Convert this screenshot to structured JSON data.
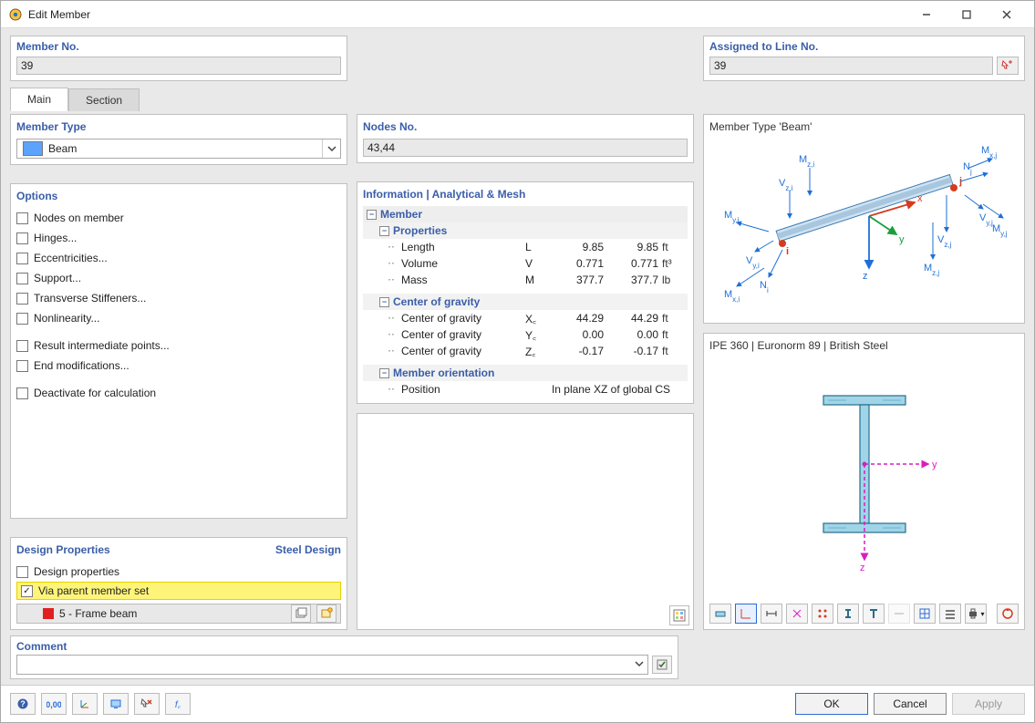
{
  "window": {
    "title": "Edit Member"
  },
  "top": {
    "member_no_label": "Member No.",
    "member_no_value": "39",
    "assigned_label": "Assigned to Line No.",
    "assigned_value": "39"
  },
  "tabs": {
    "main": "Main",
    "section": "Section"
  },
  "member_type": {
    "title": "Member Type",
    "value": "Beam"
  },
  "options": {
    "title": "Options",
    "items": [
      "Nodes on member",
      "Hinges...",
      "Eccentricities...",
      "Support...",
      "Transverse Stiffeners...",
      "Nonlinearity...",
      "Result intermediate points...",
      "End modifications...",
      "Deactivate for calculation"
    ]
  },
  "design_props": {
    "title": "Design Properties",
    "right_label": "Steel Design",
    "design_properties_label": "Design properties",
    "via_parent_label": "Via parent member set",
    "via_parent_checked": true,
    "frame_item": "5 - Frame beam"
  },
  "nodes": {
    "title": "Nodes No.",
    "value": "43,44"
  },
  "info": {
    "title": "Information | Analytical & Mesh",
    "member_label": "Member",
    "properties_label": "Properties",
    "rows": [
      {
        "name": "Length",
        "sym": "L",
        "v1": "9.85",
        "v2": "9.85",
        "unit": "ft"
      },
      {
        "name": "Volume",
        "sym": "V",
        "v1": "0.771",
        "v2": "0.771",
        "unit": "ft³"
      },
      {
        "name": "Mass",
        "sym": "M",
        "v1": "377.7",
        "v2": "377.7",
        "unit": "lb"
      }
    ],
    "cog_label": "Center of gravity",
    "cog_rows": [
      {
        "name": "Center of gravity",
        "sym": "X꜀",
        "v1": "44.29",
        "v2": "44.29",
        "unit": "ft"
      },
      {
        "name": "Center of gravity",
        "sym": "Y꜀",
        "v1": "0.00",
        "v2": "0.00",
        "unit": "ft"
      },
      {
        "name": "Center of gravity",
        "sym": "Z꜀",
        "v1": "-0.17",
        "v2": "-0.17",
        "unit": "ft"
      }
    ],
    "orientation_label": "Member orientation",
    "position_label": "Position",
    "position_value": "In plane XZ of global CS"
  },
  "preview": {
    "title": "Member Type 'Beam'",
    "section_title": "IPE 360 | Euronorm 89 | British Steel"
  },
  "comment": {
    "title": "Comment",
    "value": ""
  },
  "footer": {
    "ok": "OK",
    "cancel": "Cancel",
    "apply": "Apply"
  }
}
